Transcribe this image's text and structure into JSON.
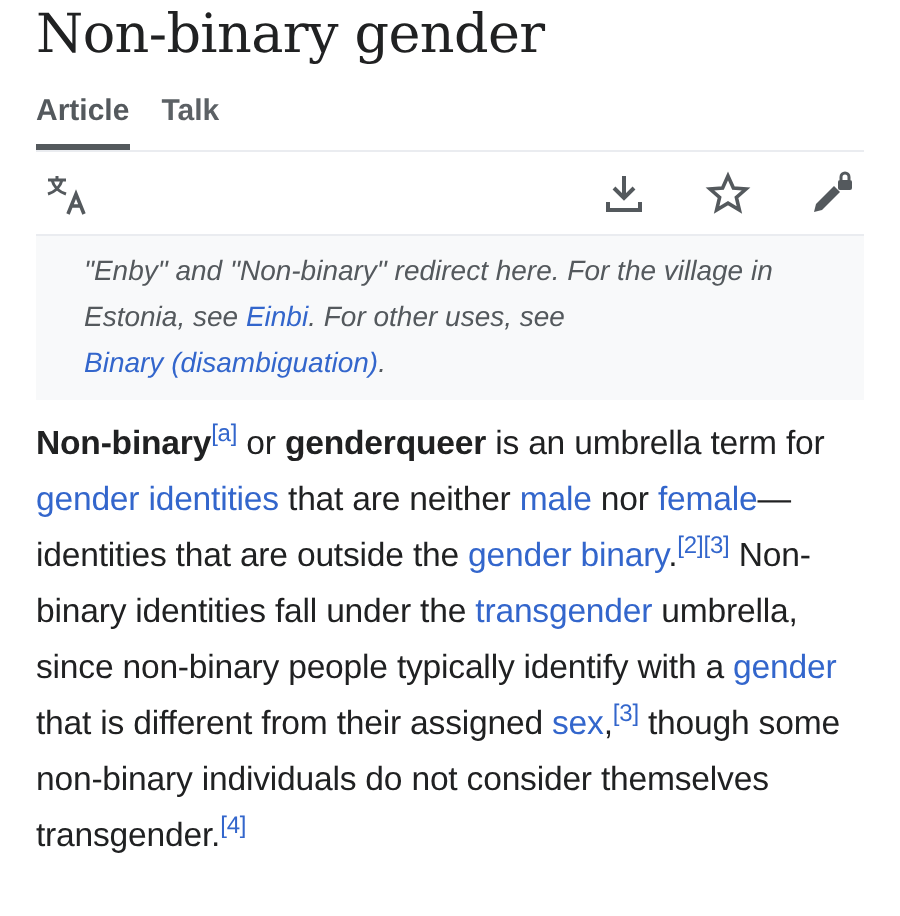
{
  "title": "Non-binary gender",
  "tabs": [
    {
      "label": "Article",
      "selected": true
    },
    {
      "label": "Talk",
      "selected": false
    }
  ],
  "toolbar": [
    {
      "kind": "language"
    },
    {
      "kind": "spacer"
    },
    {
      "kind": "download"
    },
    {
      "kind": "watch"
    },
    {
      "kind": "edit_locked"
    }
  ],
  "hatnote": [
    {
      "kind": "text",
      "text": "\"Enby\" and \"Non-binary\" redirect here. For the village in Estonia, see "
    },
    {
      "kind": "link",
      "text": "Einbi"
    },
    {
      "kind": "text",
      "text": ". For other uses, see "
    },
    {
      "kind": "link",
      "text": "Binary (disambiguation)"
    },
    {
      "kind": "text",
      "text": "."
    }
  ],
  "paragraph": [
    {
      "kind": "bold",
      "text": "Non-binary"
    },
    {
      "kind": "ref",
      "text": "[a]"
    },
    {
      "kind": "text",
      "text": " or "
    },
    {
      "kind": "bold",
      "text": "genderqueer"
    },
    {
      "kind": "text",
      "text": " is an umbrella term for "
    },
    {
      "kind": "link",
      "text": "gender identities"
    },
    {
      "kind": "text",
      "text": " that are neither "
    },
    {
      "kind": "link",
      "text": "male"
    },
    {
      "kind": "text",
      "text": " nor "
    },
    {
      "kind": "link",
      "text": "female"
    },
    {
      "kind": "text",
      "text": "—identities that are outside the "
    },
    {
      "kind": "link",
      "text": "gender binary"
    },
    {
      "kind": "text",
      "text": "."
    },
    {
      "kind": "ref",
      "text": "[2]"
    },
    {
      "kind": "ref",
      "text": "[3]"
    },
    {
      "kind": "text",
      "text": " Non-binary identities fall under the "
    },
    {
      "kind": "link",
      "text": "transgender"
    },
    {
      "kind": "text",
      "text": " umbrella, since non-binary people typically identify with a "
    },
    {
      "kind": "link",
      "text": "gender"
    },
    {
      "kind": "text",
      "text": " that is different from their assigned "
    },
    {
      "kind": "link",
      "text": "sex"
    },
    {
      "kind": "text",
      "text": ","
    },
    {
      "kind": "ref",
      "text": "[3]"
    },
    {
      "kind": "text",
      "text": " though some non-binary individuals do not consider themselves transgender."
    },
    {
      "kind": "ref",
      "text": "[4]"
    }
  ]
}
